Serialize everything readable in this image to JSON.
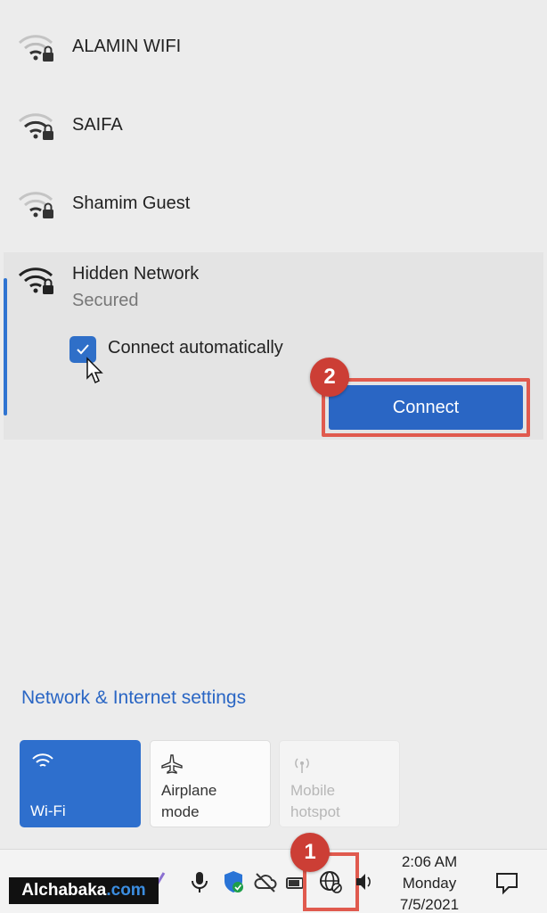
{
  "networks": [
    {
      "name": "ALAMIN WIFI",
      "icon": "wifi-lock-icon"
    },
    {
      "name": "SAIFA",
      "icon": "wifi-lock-icon"
    },
    {
      "name": "Shamim Guest",
      "icon": "wifi-lock-icon"
    }
  ],
  "expanded_network": {
    "name": "Hidden Network",
    "status": "Secured",
    "auto_connect_label": "Connect automatically",
    "auto_connect_checked": true,
    "connect_label": "Connect"
  },
  "settings_link": "Network & Internet settings",
  "quick_tiles": {
    "wifi": {
      "label": "Wi-Fi",
      "active": true
    },
    "airplane": {
      "line1": "Airplane",
      "line2": "mode",
      "active": false
    },
    "hotspot": {
      "line1": "Mobile",
      "line2": "hotspot",
      "enabled": false
    }
  },
  "annotations": {
    "step1": "1",
    "step2": "2",
    "highlight_color": "#e05a4e"
  },
  "taskbar": {
    "brand_name": "Alchabaka",
    "brand_tld": ".com",
    "clock": {
      "time": "2:06 AM",
      "day": "Monday",
      "date": "7/5/2021"
    },
    "tray_icons": [
      "pen-icon",
      "microphone-icon",
      "security-shield-icon",
      "cloud-offline-icon",
      "battery-icon",
      "globe-network-icon",
      "speaker-icon"
    ]
  },
  "colors": {
    "accent": "#2a66c4",
    "badge": "#cc3e35"
  }
}
